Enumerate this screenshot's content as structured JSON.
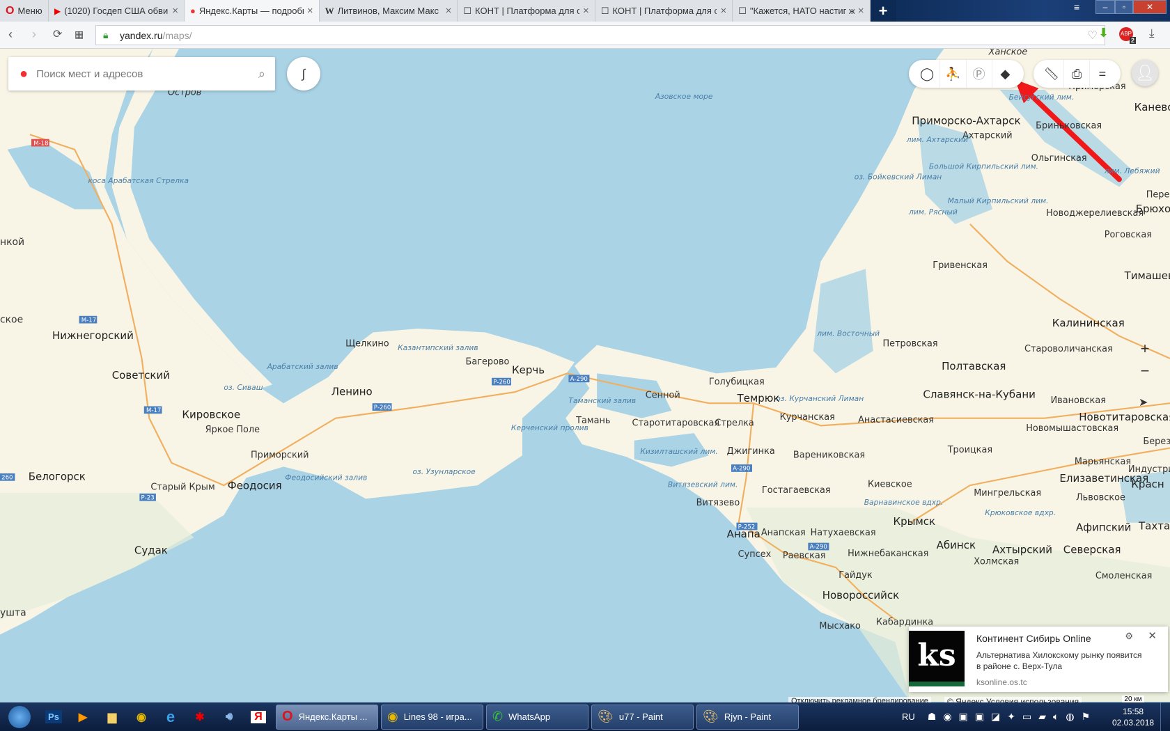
{
  "browser": {
    "menu_label": "Меню",
    "tabs": [
      {
        "title": "(1020) Госдеп США обвин",
        "icon": "youtube-icon"
      },
      {
        "title": "Яндекс.Карты — подробн",
        "icon": "yandex-maps-pin-icon",
        "active": true
      },
      {
        "title": "Литвинов, Максим Макс",
        "icon": "wikipedia-icon"
      },
      {
        "title": "КОНТ | Платформа для со",
        "icon": "kont-icon"
      },
      {
        "title": "КОНТ | Платформа для со",
        "icon": "kont-icon"
      },
      {
        "title": "\"Кажется, НАТО настиг ж",
        "icon": "kont-icon"
      }
    ],
    "new_tab": "+",
    "url_host": "yandex.ru",
    "url_path": "/maps/",
    "abp_badge": "2"
  },
  "map": {
    "search_placeholder": "Поиск мест и адресов",
    "colors": {
      "sea": "#aad3e5",
      "land": "#f8f4e6",
      "accent_red": "#f03030"
    },
    "toolbar": [
      "traffic-icon",
      "panorama-icon",
      "parking-icon",
      "layers-icon",
      "ruler-icon",
      "print-icon",
      "menu-icon"
    ],
    "zoom_in": "+",
    "zoom_out": "−",
    "cities": [
      "Керчь",
      "Ленино",
      "Нижнегорский",
      "Советский",
      "Кировское",
      "Феодосия",
      "Белогорск",
      "Судак",
      "Анапа",
      "Темрюк",
      "Крымск",
      "Новороссийск",
      "Славянск-на-Кубани",
      "Полтавская",
      "Приморско-Ахтарск",
      "Калининская",
      "Абинск",
      "Ахтырский",
      "Елизаветинская",
      "Новотитаровская",
      "Тимашевск",
      "Брюховецкая",
      "Каневская",
      "Красн",
      "Тахтам",
      "Афипский",
      "Северская"
    ],
    "towns": [
      "Щелкино",
      "Багерово",
      "Яркое Поле",
      "Приморский",
      "Старый Крым",
      "Тамань",
      "Сенной",
      "Голубицкая",
      "Старотитаровская",
      "Стрелка",
      "Джигинка",
      "Курчанская",
      "Варениковская",
      "Анастасиевская",
      "Гостагаевская",
      "Витязево",
      "Супсех",
      "Раевская",
      "Анапская",
      "Натухаевская",
      "Нижнебаканская",
      "Гайдук",
      "Мысхако",
      "Кабардинка",
      "Киевское",
      "Троицкая",
      "Мингрельская",
      "Холмская",
      "Смоленская",
      "Марьянская",
      "Львовское",
      "Новомышастовская",
      "Ивановская",
      "Староволичанская",
      "Петровская",
      "Гривенская",
      "Роговская",
      "Новоджерелиевская",
      "Ольгинская",
      "Ахтарский",
      "Бриньковская",
      "Приморская",
      "Индустрия",
      "Березо",
      "Переяслов",
      "Остров",
      "Ханское",
      "нкой",
      "ское",
      "ушта"
    ],
    "water": [
      "Азовское море",
      "Арабатский залив",
      "оз. Сиваш",
      "Казантипский залив",
      "Керченский пролив",
      "Таманский залив",
      "Феодосийский залив",
      "оз. Узунларское",
      "Кизилташский лим.",
      "Витязевский лим.",
      "оз. Курчанский Лиман",
      "лим. Восточный",
      "оз. Бойкевский Лиман",
      "лим. Ахтарский",
      "Большой Кирпильский лим.",
      "Малый Кирпильский лим.",
      "Бейсугский лим.",
      "лим. Лебяжий",
      "Варнавинское вдхр.",
      "Крюковское вдхр.",
      "коса Арабатская Стрелка",
      "лим. Рясный"
    ],
    "roads": [
      "М-18",
      "М-17",
      "М-17",
      "Р-260",
      "Р-260",
      "А-290",
      "А-290",
      "Р-23",
      "Р-252",
      "А-290",
      "260"
    ],
    "disable_ads": "Отключить рекламное брендирование",
    "copyright": "© Яндекс",
    "terms": "Условия использования",
    "scale": "20 км"
  },
  "notification": {
    "logo": "ks",
    "title": "Континент Сибирь Online",
    "body": "Альтернатива Хилокскому рынку появится в районе с. Верх-Тула",
    "source": "ksonline.os.tc"
  },
  "taskbar": {
    "pinned": [
      "start-icon",
      "photoshop-icon",
      "media-player-icon",
      "explorer-icon",
      "chrome-icon",
      "ie-icon",
      "game-icon",
      "volume-app-icon",
      "yandex-icon"
    ],
    "windows": [
      {
        "label": "Яндекс.Карты ...",
        "icon": "opera-icon",
        "active": true
      },
      {
        "label": "Lines 98 - игра...",
        "icon": "chrome-icon"
      },
      {
        "label": "WhatsApp",
        "icon": "whatsapp-icon"
      },
      {
        "label": "u77 - Paint",
        "icon": "paint-icon"
      },
      {
        "label": "Rjyn - Paint",
        "icon": "paint-icon"
      }
    ],
    "lang": "RU",
    "time": "15:58",
    "date": "02.03.2018"
  }
}
